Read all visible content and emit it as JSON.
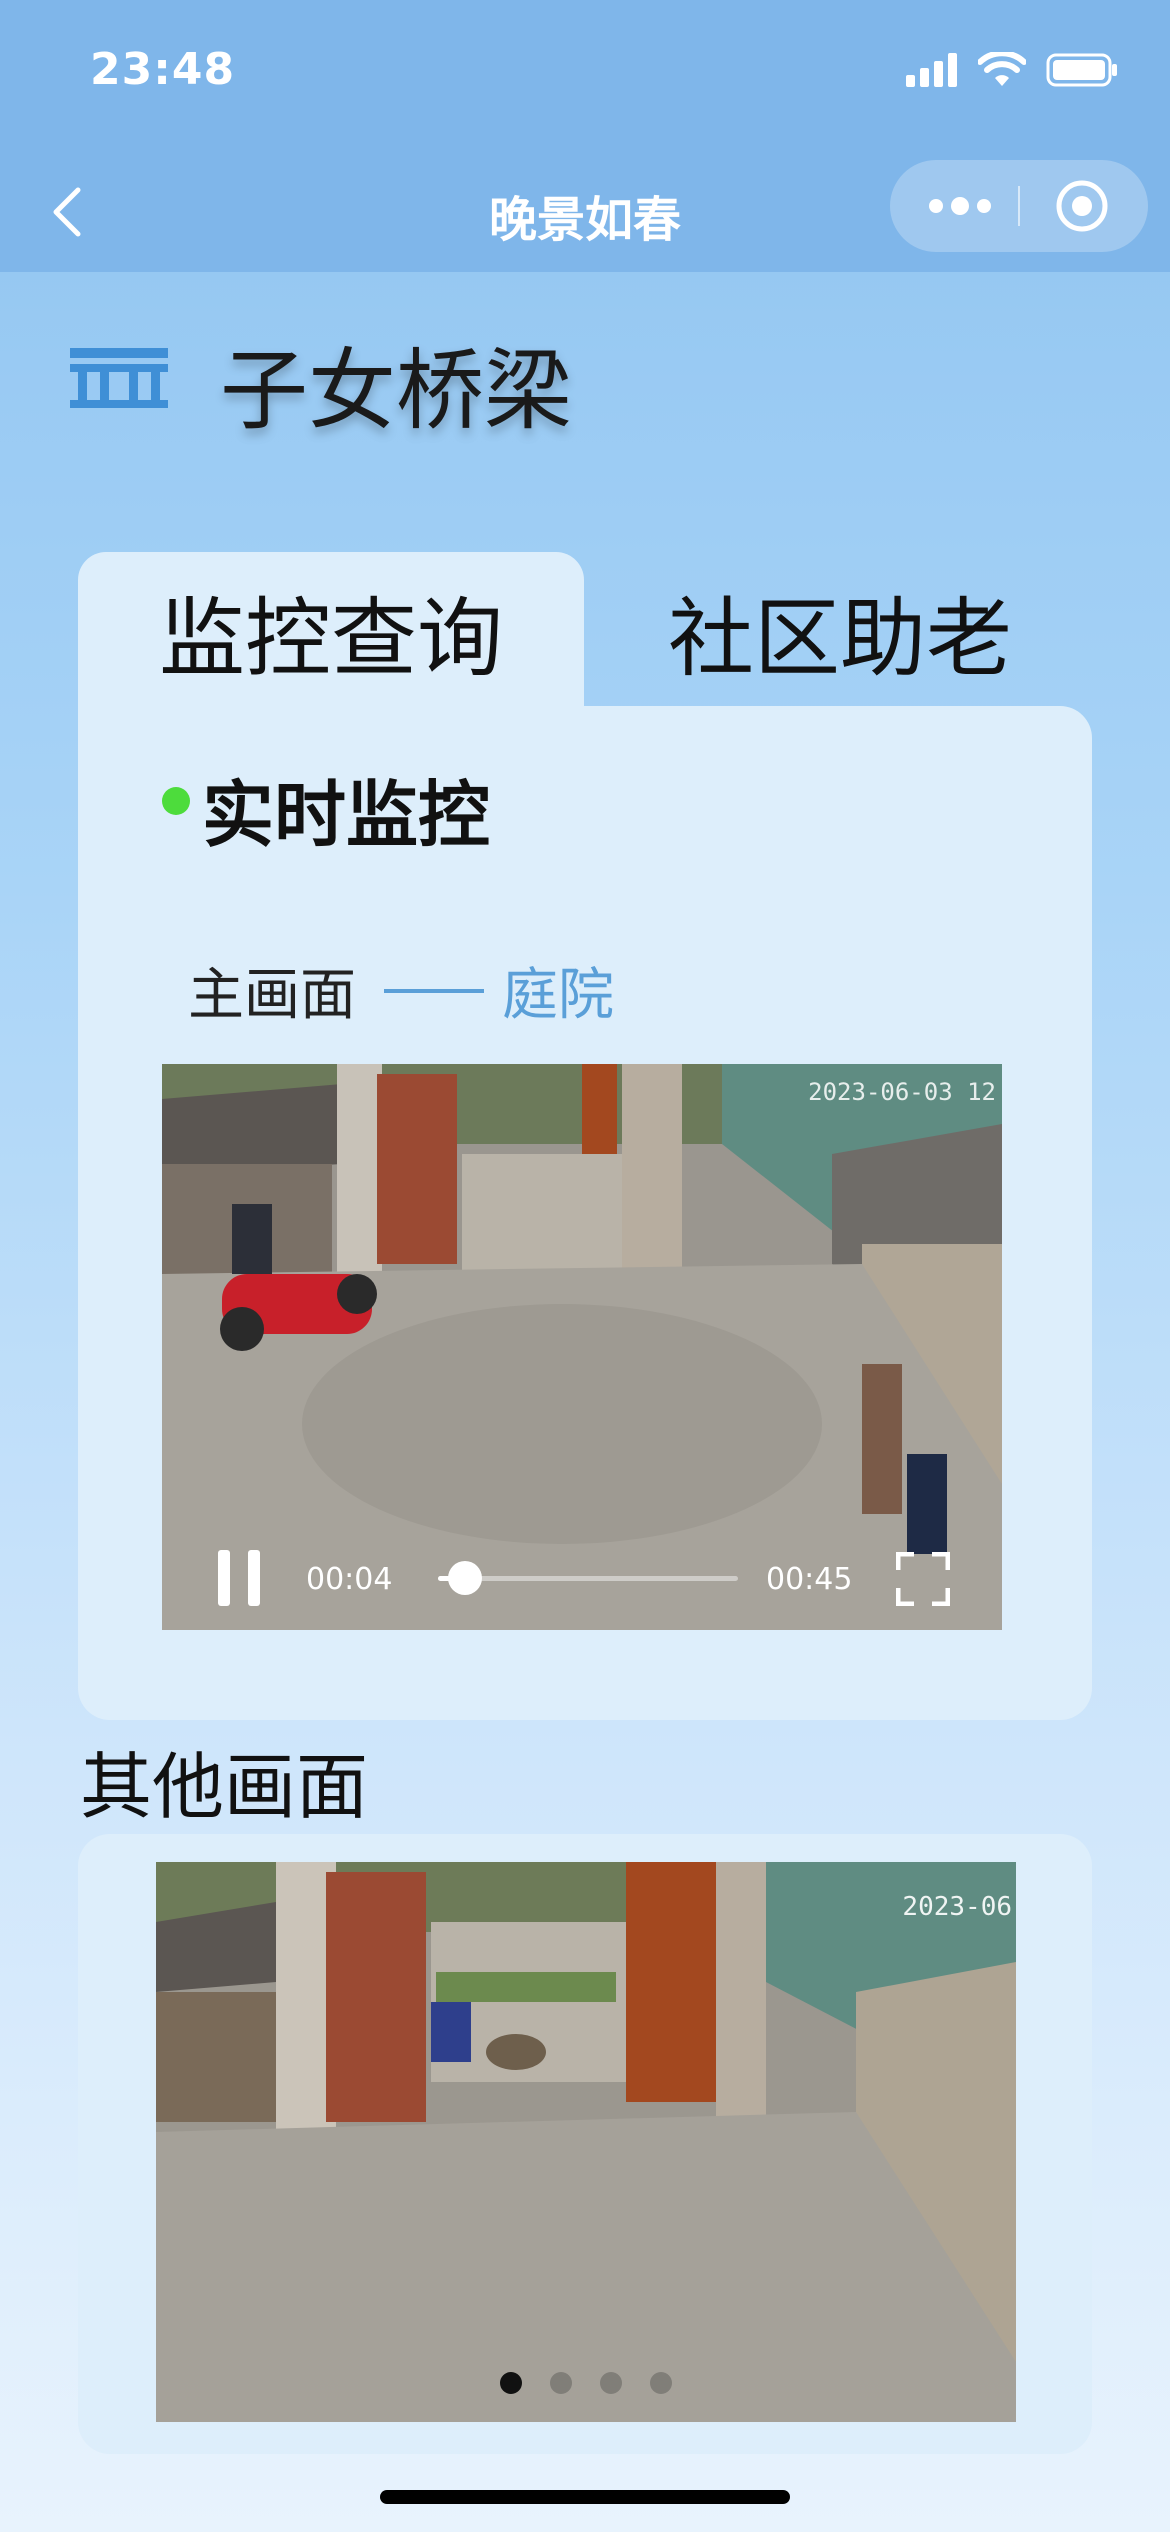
{
  "status": {
    "time": "23:48"
  },
  "nav": {
    "title": "晚景如春"
  },
  "section": {
    "title": "子女桥梁"
  },
  "tabs": [
    {
      "label": "监控查询",
      "active": true
    },
    {
      "label": "社区助老",
      "active": false
    }
  ],
  "live": {
    "title": "实时监控",
    "main_label": "主画面",
    "location": "庭院",
    "video": {
      "timestamp": "2023-06-03 12",
      "current_time": "00:04",
      "total_time": "00:45",
      "progress": 0.09,
      "playing": true
    }
  },
  "other": {
    "title": "其他画面",
    "timestamp": "2023-06",
    "carousel_total": 4,
    "carousel_active": 0
  },
  "colors": {
    "accent": "#5a9fd8",
    "live_dot": "#4ddc3c",
    "nav": "#7fb6ea"
  }
}
